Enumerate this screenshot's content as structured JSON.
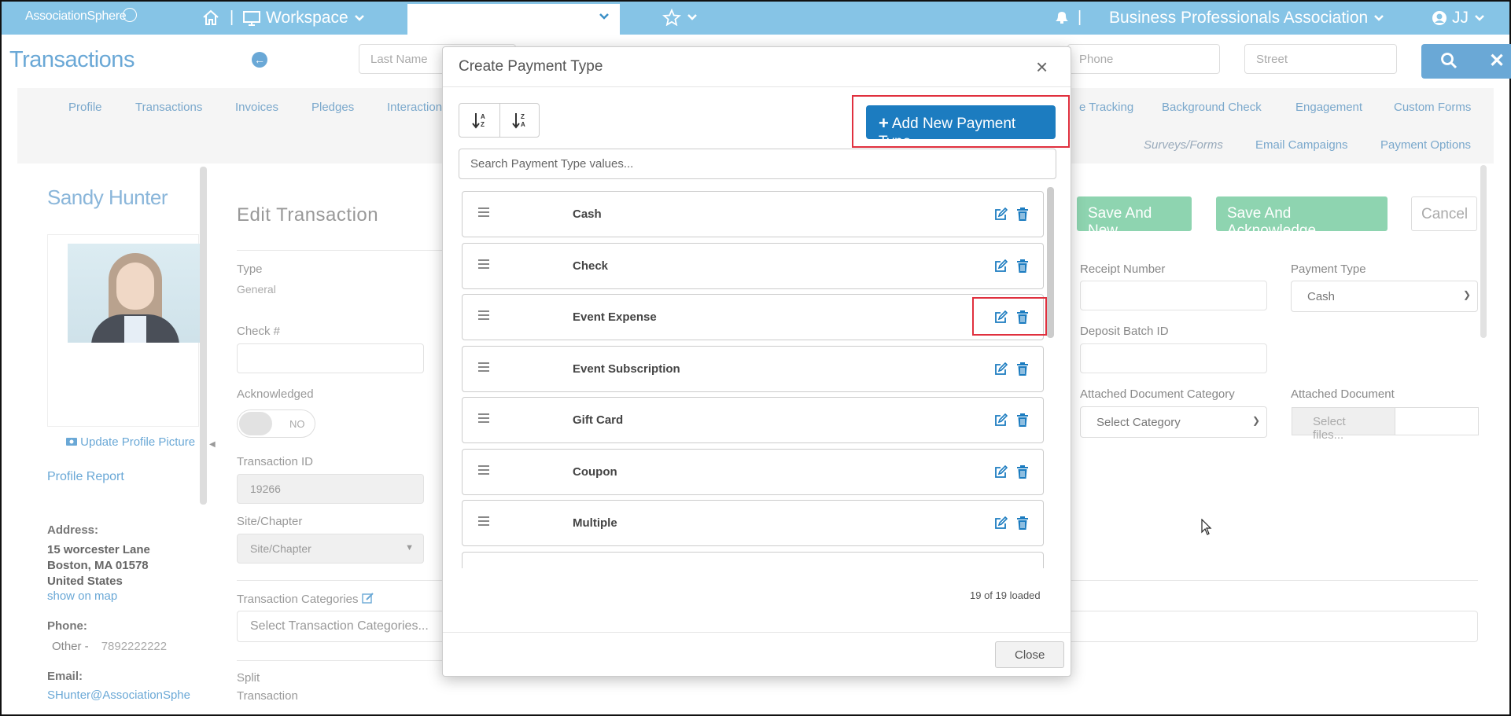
{
  "topbar": {
    "logo_text": "AssociationSphere",
    "workspace_label": "Workspace",
    "separator": "|",
    "organization": "Business Professionals Association",
    "user_initials": "JJ"
  },
  "page": {
    "title": "Transactions",
    "search": {
      "last_name_placeholder": "Last Name",
      "phone_placeholder": "Phone",
      "street_placeholder": "Street"
    }
  },
  "nav": {
    "row1": [
      "Profile",
      "Transactions",
      "Invoices",
      "Pledges",
      "Interaction",
      "e Tracking",
      "Background Check",
      "Engagement",
      "Custom Forms"
    ],
    "row2": [
      "Surveys/Forms",
      "Email Campaigns",
      "Payment Options"
    ]
  },
  "profile": {
    "name": "Sandy Hunter",
    "update_picture": "Update Profile Picture",
    "profile_report": "Profile Report",
    "address_label": "Address:",
    "address_lines": [
      "15 worcester Lane",
      "Boston, MA 01578",
      "United States"
    ],
    "show_on_map": "show on map",
    "phone_label": "Phone:",
    "phone_type": "Other -",
    "phone_number": "7892222222",
    "email_label": "Email:",
    "email": "SHunter@AssociationSphe"
  },
  "edit_transaction": {
    "title": "Edit Transaction",
    "type_label": "Type",
    "type_value": "General",
    "check_label": "Check #",
    "acknowledged_label": "Acknowledged",
    "toggle_text": "NO",
    "transaction_id_label": "Transaction ID",
    "transaction_id_value": "19266",
    "site_label": "Site/Chapter",
    "site_placeholder": "Site/Chapter",
    "categories_label": "Transaction Categories",
    "categories_placeholder": "Select Transaction Categories...",
    "split_label_1": "Split",
    "split_label_2": "Transaction",
    "save_new": "Save And New",
    "save_ack": "Save And Acknowledge",
    "cancel": "Cancel",
    "receipt_label": "Receipt Number",
    "payment_type_label": "Payment Type",
    "payment_type_value": "Cash",
    "deposit_label": "Deposit Batch ID",
    "doc_category_label": "Attached Document Category",
    "doc_category_value": "Select Category",
    "attached_doc_label": "Attached Document",
    "select_files": "Select files..."
  },
  "modal": {
    "title": "Create Payment Type",
    "close_x": "×",
    "add_button": "Add New Payment Type",
    "search_placeholder": "Search Payment Type values...",
    "items": [
      "Cash",
      "Check",
      "Event Expense",
      "Event Subscription",
      "Gift Card",
      "Coupon",
      "Multiple"
    ],
    "loaded_text": "19 of 19 loaded",
    "close_button": "Close"
  },
  "colors": {
    "topbar": "#86c4e6",
    "primary": "#1c7cc0",
    "highlight": "#e0303e",
    "save_green": "#8ed4b0"
  },
  "icons": [
    "home-icon",
    "monitor-icon",
    "chevron-down-icon",
    "star-icon",
    "bell-icon",
    "user-circle-icon",
    "search-icon",
    "close-icon",
    "sort-asc-icon",
    "sort-desc-icon",
    "grip-icon",
    "edit-icon",
    "trash-icon",
    "camera-icon",
    "pencil-icon"
  ]
}
